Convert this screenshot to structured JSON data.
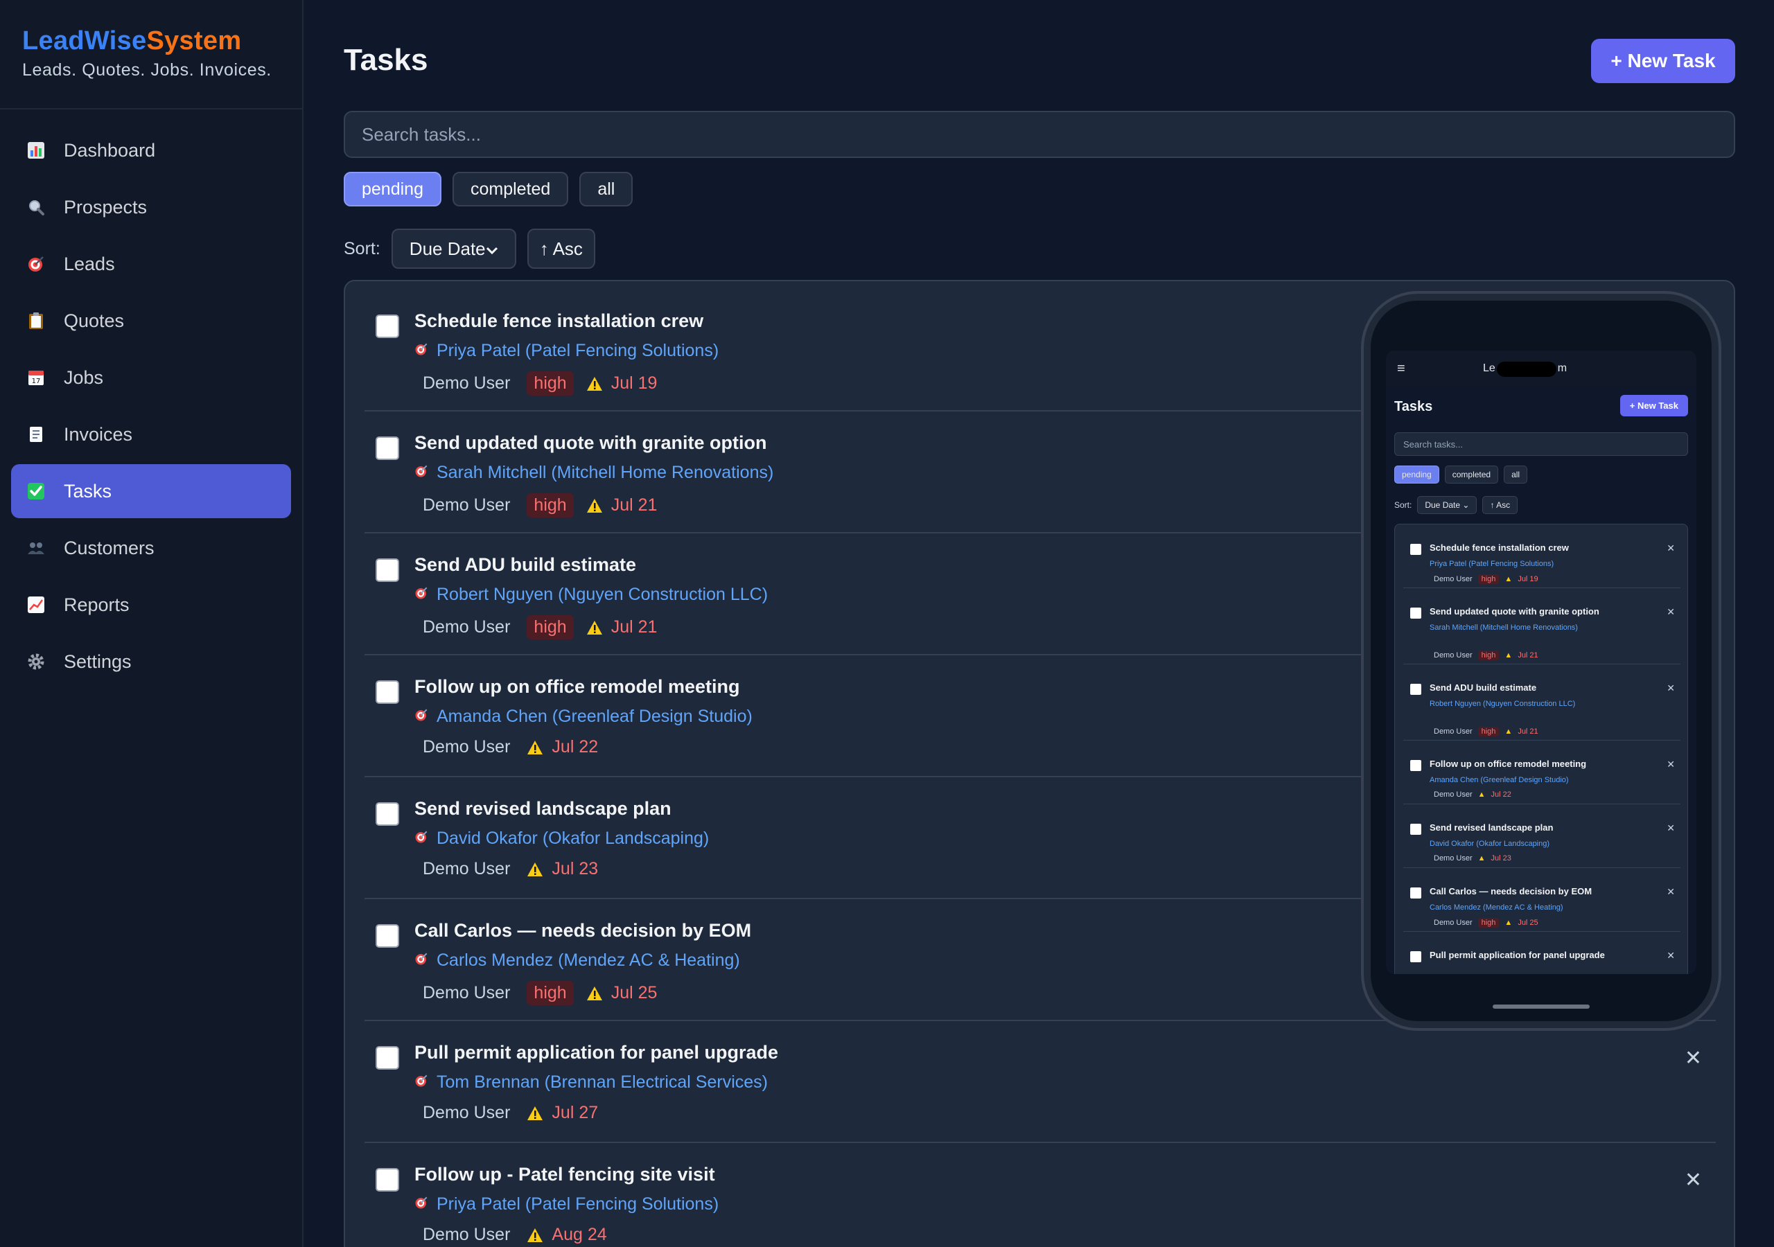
{
  "brand": {
    "part1": "LeadWise",
    "part2": "System",
    "tagline": "Leads. Quotes. Jobs. Invoices."
  },
  "nav": [
    {
      "label": "Dashboard",
      "icon": "bar-chart-icon"
    },
    {
      "label": "Prospects",
      "icon": "magnifier-icon"
    },
    {
      "label": "Leads",
      "icon": "target-icon"
    },
    {
      "label": "Quotes",
      "icon": "clipboard-icon"
    },
    {
      "label": "Jobs",
      "icon": "calendar-icon"
    },
    {
      "label": "Invoices",
      "icon": "receipt-icon"
    },
    {
      "label": "Tasks",
      "icon": "checkmark-icon",
      "active": true
    },
    {
      "label": "Customers",
      "icon": "people-icon"
    },
    {
      "label": "Reports",
      "icon": "line-chart-icon"
    },
    {
      "label": "Settings",
      "icon": "gear-icon"
    }
  ],
  "header": {
    "title": "Tasks",
    "new_button": "+ New Task"
  },
  "search": {
    "placeholder": "Search tasks..."
  },
  "filters": {
    "pending": "pending",
    "completed": "completed",
    "all": "all",
    "active": "pending"
  },
  "sort": {
    "label": "Sort:",
    "field": "Due Date",
    "direction": "↑ Asc"
  },
  "tasks": [
    {
      "title": "Schedule fence installation crew",
      "lead": "Priya Patel (Patel Fencing Solutions)",
      "owner": "Demo User",
      "priority": "high",
      "due": "Jul 19"
    },
    {
      "title": "Send updated quote with granite option",
      "lead": "Sarah Mitchell (Mitchell Home Renovations)",
      "owner": "Demo User",
      "priority": "high",
      "due": "Jul 21"
    },
    {
      "title": "Send ADU build estimate",
      "lead": "Robert Nguyen (Nguyen Construction LLC)",
      "owner": "Demo User",
      "priority": "high",
      "due": "Jul 21"
    },
    {
      "title": "Follow up on office remodel meeting",
      "lead": "Amanda Chen (Greenleaf Design Studio)",
      "owner": "Demo User",
      "priority": "",
      "due": "Jul 22"
    },
    {
      "title": "Send revised landscape plan",
      "lead": "David Okafor (Okafor Landscaping)",
      "owner": "Demo User",
      "priority": "",
      "due": "Jul 23"
    },
    {
      "title": "Call Carlos — needs decision by EOM",
      "lead": "Carlos Mendez (Mendez AC & Heating)",
      "owner": "Demo User",
      "priority": "high",
      "due": "Jul 25"
    },
    {
      "title": "Pull permit application for panel upgrade",
      "lead": "Tom Brennan (Brennan Electrical Services)",
      "owner": "Demo User",
      "priority": "",
      "due": "Jul 27"
    },
    {
      "title": "Follow up - Patel fencing site visit",
      "lead": "Priya Patel (Patel Fencing Solutions)",
      "owner": "Demo User",
      "priority": "",
      "due": "Aug 24"
    }
  ],
  "phone": {
    "brand_left": "Le",
    "brand_right": "m",
    "menu_icon": "hamburger-icon",
    "title": "Tasks",
    "new_button": "+ New Task",
    "search_placeholder": "Search tasks...",
    "filters": [
      "pending",
      "completed",
      "all"
    ],
    "sort_label": "Sort:",
    "sort_field": "Due Date",
    "sort_dir": "↑ Asc",
    "tasks": [
      {
        "title": "Schedule fence installation crew",
        "lead": "Priya Patel (Patel Fencing Solutions)",
        "owner": "Demo User",
        "priority": "high",
        "due": "Jul 19"
      },
      {
        "title": "Send updated quote with granite option",
        "lead": "Sarah Mitchell (Mitchell Home Renovations)",
        "owner": "Demo User",
        "priority": "high",
        "due": "Jul 21"
      },
      {
        "title": "Send ADU build estimate",
        "lead": "Robert Nguyen (Nguyen Construction LLC)",
        "owner": "Demo User",
        "priority": "high",
        "due": "Jul 21"
      },
      {
        "title": "Follow up on office remodel meeting",
        "lead": "Amanda Chen (Greenleaf Design Studio)",
        "owner": "Demo User",
        "priority": "",
        "due": "Jul 22"
      },
      {
        "title": "Send revised landscape plan",
        "lead": "David Okafor (Okafor Landscaping)",
        "owner": "Demo User",
        "priority": "",
        "due": "Jul 23"
      },
      {
        "title": "Call Carlos — needs decision by EOM",
        "lead": "Carlos Mendez (Mendez AC & Heating)",
        "owner": "Demo User",
        "priority": "high",
        "due": "Jul 25"
      },
      {
        "title": "Pull permit application for panel upgrade",
        "lead": "",
        "owner": "",
        "priority": "",
        "due": ""
      }
    ]
  },
  "colors": {
    "accent": "#6366f1",
    "active_nav": "#4f5bd5",
    "link": "#60a5fa",
    "danger": "#f87171",
    "warning": "#facc15"
  }
}
